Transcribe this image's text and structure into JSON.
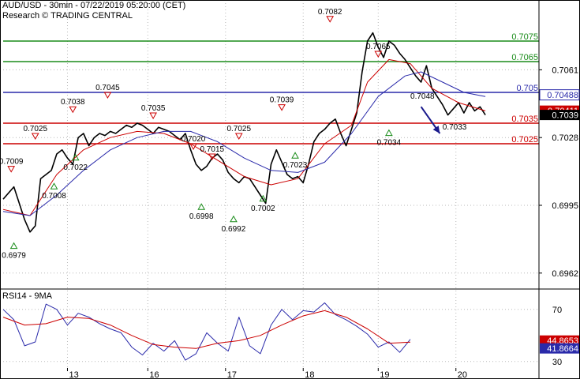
{
  "header": {
    "title": "AUD/USD - 30min - 07/22/2019 05:20:00 (CET)",
    "subtitle": "Research © TRADING CENTRAL"
  },
  "colors": {
    "background": "#ffffff",
    "grid": "#b8b8b8",
    "price": "#000000",
    "ma_fast": "#cc0000",
    "ma_slow": "#2a2aaa",
    "resistance": "#1a8c1a",
    "pivot": "#2a2aaa",
    "support": "#cc0000",
    "current_label_bg": "#000000",
    "arrow": "#1a1a8c"
  },
  "chart_data": [
    {
      "id": "price",
      "type": "line",
      "title": "AUD/USD - 30min - 07/22/2019 05:20:00 (CET)",
      "xlabel": "",
      "ylabel": "",
      "x_ticks": [
        "13",
        "16",
        "17",
        "18",
        "19",
        "20"
      ],
      "y_ticks": [
        0.7061,
        0.7028,
        0.6995,
        0.6962
      ],
      "ylim": [
        0.6955,
        0.7085
      ],
      "grid": true,
      "x_range": [
        0,
        100
      ],
      "x_tick_positions": [
        12,
        27,
        41.5,
        56,
        70,
        84.5
      ],
      "series": [
        {
          "name": "",
          "style": "price",
          "x": [
            0,
            2,
            4,
            5,
            6,
            7,
            9,
            10,
            11,
            12,
            13,
            14,
            15,
            16,
            17,
            18,
            19,
            20,
            21,
            22,
            23,
            24,
            25,
            26,
            27,
            28,
            29,
            30,
            31,
            32,
            33,
            34,
            35,
            36,
            37,
            38,
            39,
            40,
            41,
            42,
            43,
            44,
            45,
            46,
            47,
            48,
            49,
            50,
            51,
            52,
            53,
            54,
            55,
            56,
            57,
            58,
            59,
            60,
            61,
            62,
            63,
            64,
            65,
            66,
            67,
            68,
            69,
            70,
            71,
            72,
            73,
            74,
            75,
            76,
            77,
            78,
            79,
            80,
            81,
            82,
            83,
            84,
            85,
            86,
            87,
            88,
            89,
            90
          ],
          "y": [
            0.6998,
            0.7004,
            0.6988,
            0.6982,
            0.6985,
            0.7008,
            0.7012,
            0.702,
            0.7022,
            0.7018,
            0.7015,
            0.7028,
            0.703,
            0.7024,
            0.7028,
            0.703,
            0.7029,
            0.7031,
            0.703,
            0.7032,
            0.7034,
            0.7033,
            0.7035,
            0.7034,
            0.7032,
            0.703,
            0.7033,
            0.7032,
            0.7031,
            0.7029,
            0.7027,
            0.703,
            0.7022,
            0.7015,
            0.7012,
            0.7014,
            0.7018,
            0.702,
            0.7017,
            0.7011,
            0.7008,
            0.7006,
            0.7009,
            0.7008,
            0.7004,
            0.7,
            0.6996,
            0.7015,
            0.7022,
            0.7016,
            0.701,
            0.7008,
            0.7009,
            0.7006,
            0.7015,
            0.7026,
            0.703,
            0.7032,
            0.7035,
            0.7037,
            0.703,
            0.7024,
            0.7032,
            0.704,
            0.706,
            0.7075,
            0.7079,
            0.7072,
            0.7067,
            0.7075,
            0.7073,
            0.7069,
            0.7066,
            0.7062,
            0.7058,
            0.7055,
            0.7063,
            0.7052,
            0.7048,
            0.7044,
            0.7039,
            0.7042,
            0.7045,
            0.704,
            0.7045,
            0.7041,
            0.7043,
            0.7039
          ]
        },
        {
          "name": "",
          "style": "ma_fast",
          "x": [
            0,
            5,
            10,
            15,
            20,
            25,
            30,
            35,
            40,
            45,
            50,
            55,
            60,
            65,
            68,
            72,
            76,
            80,
            85,
            90
          ],
          "y": [
            0.6993,
            0.699,
            0.701,
            0.7022,
            0.7028,
            0.7031,
            0.703,
            0.7025,
            0.7017,
            0.7009,
            0.7005,
            0.7008,
            0.7025,
            0.7034,
            0.7055,
            0.7066,
            0.7064,
            0.7052,
            0.7045,
            0.7041
          ]
        },
        {
          "name": "",
          "style": "ma_slow",
          "x": [
            0,
            5,
            10,
            15,
            20,
            25,
            30,
            35,
            40,
            45,
            50,
            55,
            60,
            65,
            70,
            75,
            78,
            82,
            86,
            90
          ],
          "y": [
            0.6992,
            0.699,
            0.7,
            0.7012,
            0.7022,
            0.7028,
            0.7031,
            0.7031,
            0.7026,
            0.7018,
            0.7012,
            0.7011,
            0.7016,
            0.703,
            0.7048,
            0.7058,
            0.706,
            0.7055,
            0.705,
            0.7048
          ]
        }
      ],
      "levels": [
        {
          "value": 0.7075,
          "label": "0.7075",
          "style": "resistance"
        },
        {
          "value": 0.7065,
          "label": "0.7065",
          "style": "resistance"
        },
        {
          "value": 0.705,
          "label": "0.705",
          "style": "pivot"
        },
        {
          "value": 0.7035,
          "label": "0.7035",
          "style": "support"
        },
        {
          "value": 0.7025,
          "label": "0.7025",
          "style": "support"
        }
      ],
      "annotations": [
        {
          "x": 1.5,
          "y": 0.7009,
          "label": "0.7009",
          "kind": "high"
        },
        {
          "x": 6,
          "y": 0.7025,
          "label": "0.7025",
          "kind": "high"
        },
        {
          "x": 13,
          "y": 0.7038,
          "label": "0.7038",
          "kind": "high"
        },
        {
          "x": 19.5,
          "y": 0.7045,
          "label": "0.7045",
          "kind": "high"
        },
        {
          "x": 28,
          "y": 0.7035,
          "label": "0.7035",
          "kind": "high"
        },
        {
          "x": 35.5,
          "y": 0.702,
          "label": "0.7020",
          "kind": "high"
        },
        {
          "x": 39,
          "y": 0.7015,
          "label": "0.7015",
          "kind": "high"
        },
        {
          "x": 44,
          "y": 0.7025,
          "label": "0.7025",
          "kind": "high"
        },
        {
          "x": 52,
          "y": 0.7039,
          "label": "0.7039",
          "kind": "high"
        },
        {
          "x": 61,
          "y": 0.7082,
          "label": "0.7082",
          "kind": "high"
        },
        {
          "x": 70,
          "y": 0.7065,
          "label": "0.7065",
          "kind": "high"
        },
        {
          "x": 2,
          "y": 0.6979,
          "label": "0.6979",
          "kind": "low"
        },
        {
          "x": 9.5,
          "y": 0.7008,
          "label": "0.7008",
          "kind": "low"
        },
        {
          "x": 13.5,
          "y": 0.7022,
          "label": "0.7022",
          "kind": "low"
        },
        {
          "x": 37,
          "y": 0.6998,
          "label": "0.6998",
          "kind": "low"
        },
        {
          "x": 43,
          "y": 0.6992,
          "label": "0.6992",
          "kind": "low"
        },
        {
          "x": 48.5,
          "y": 0.7002,
          "label": "0.7002",
          "kind": "low"
        },
        {
          "x": 54.5,
          "y": 0.7023,
          "label": "0.7023",
          "kind": "low"
        },
        {
          "x": 72,
          "y": 0.7034,
          "label": "0.7034",
          "kind": "low"
        }
      ],
      "callouts": [
        {
          "x": 76,
          "y": 0.7048,
          "label": "0.7048"
        },
        {
          "x": 82,
          "y": 0.7033,
          "label": "0.7033"
        }
      ],
      "right_labels": [
        {
          "value": 0.70488,
          "label": "0.70488",
          "style": "pivot"
        },
        {
          "value": 0.70411,
          "label": "0.70411",
          "style": "support"
        },
        {
          "value": 0.7039,
          "label": "0.7039",
          "style": "current"
        }
      ],
      "forecast_arrow": {
        "from": [
          78,
          0.7043
        ],
        "to": [
          81.5,
          0.703
        ]
      }
    },
    {
      "id": "rsi",
      "type": "line",
      "title": "RSI14 - 9MA",
      "ylim": [
        25,
        85
      ],
      "y_ticks": [
        70,
        30
      ],
      "grid": true,
      "x_range": [
        0,
        100
      ],
      "series": [
        {
          "name": "RSI14",
          "style": "rsi",
          "x": [
            0,
            2,
            4,
            6,
            8,
            10,
            12,
            14,
            16,
            18,
            20,
            22,
            24,
            26,
            28,
            30,
            32,
            34,
            36,
            38,
            40,
            42,
            44,
            46,
            48,
            50,
            52,
            54,
            56,
            58,
            60,
            62,
            64,
            66,
            68,
            70,
            72,
            74,
            76
          ],
          "y": [
            70,
            62,
            42,
            45,
            74,
            70,
            58,
            67,
            64,
            59,
            55,
            52,
            41,
            35,
            44,
            38,
            46,
            31,
            36,
            52,
            44,
            38,
            64,
            42,
            36,
            58,
            70,
            62,
            69,
            68,
            75,
            66,
            62,
            57,
            51,
            41,
            45,
            37,
            47
          ]
        },
        {
          "name": "9MA",
          "style": "rsi_ma",
          "x": [
            0,
            4,
            8,
            12,
            16,
            20,
            24,
            28,
            32,
            36,
            40,
            44,
            48,
            52,
            56,
            60,
            64,
            68,
            72,
            76
          ],
          "y": [
            64,
            58,
            59,
            64,
            63,
            58,
            50,
            43,
            41,
            40,
            44,
            46,
            50,
            58,
            65,
            69,
            64,
            55,
            44,
            44.8
          ]
        }
      ],
      "right_labels": [
        {
          "value": 44.8653,
          "label": "44.8653",
          "style": "support"
        },
        {
          "value": 41.8664,
          "label": "41.8664",
          "style": "rsi_current"
        }
      ]
    }
  ]
}
